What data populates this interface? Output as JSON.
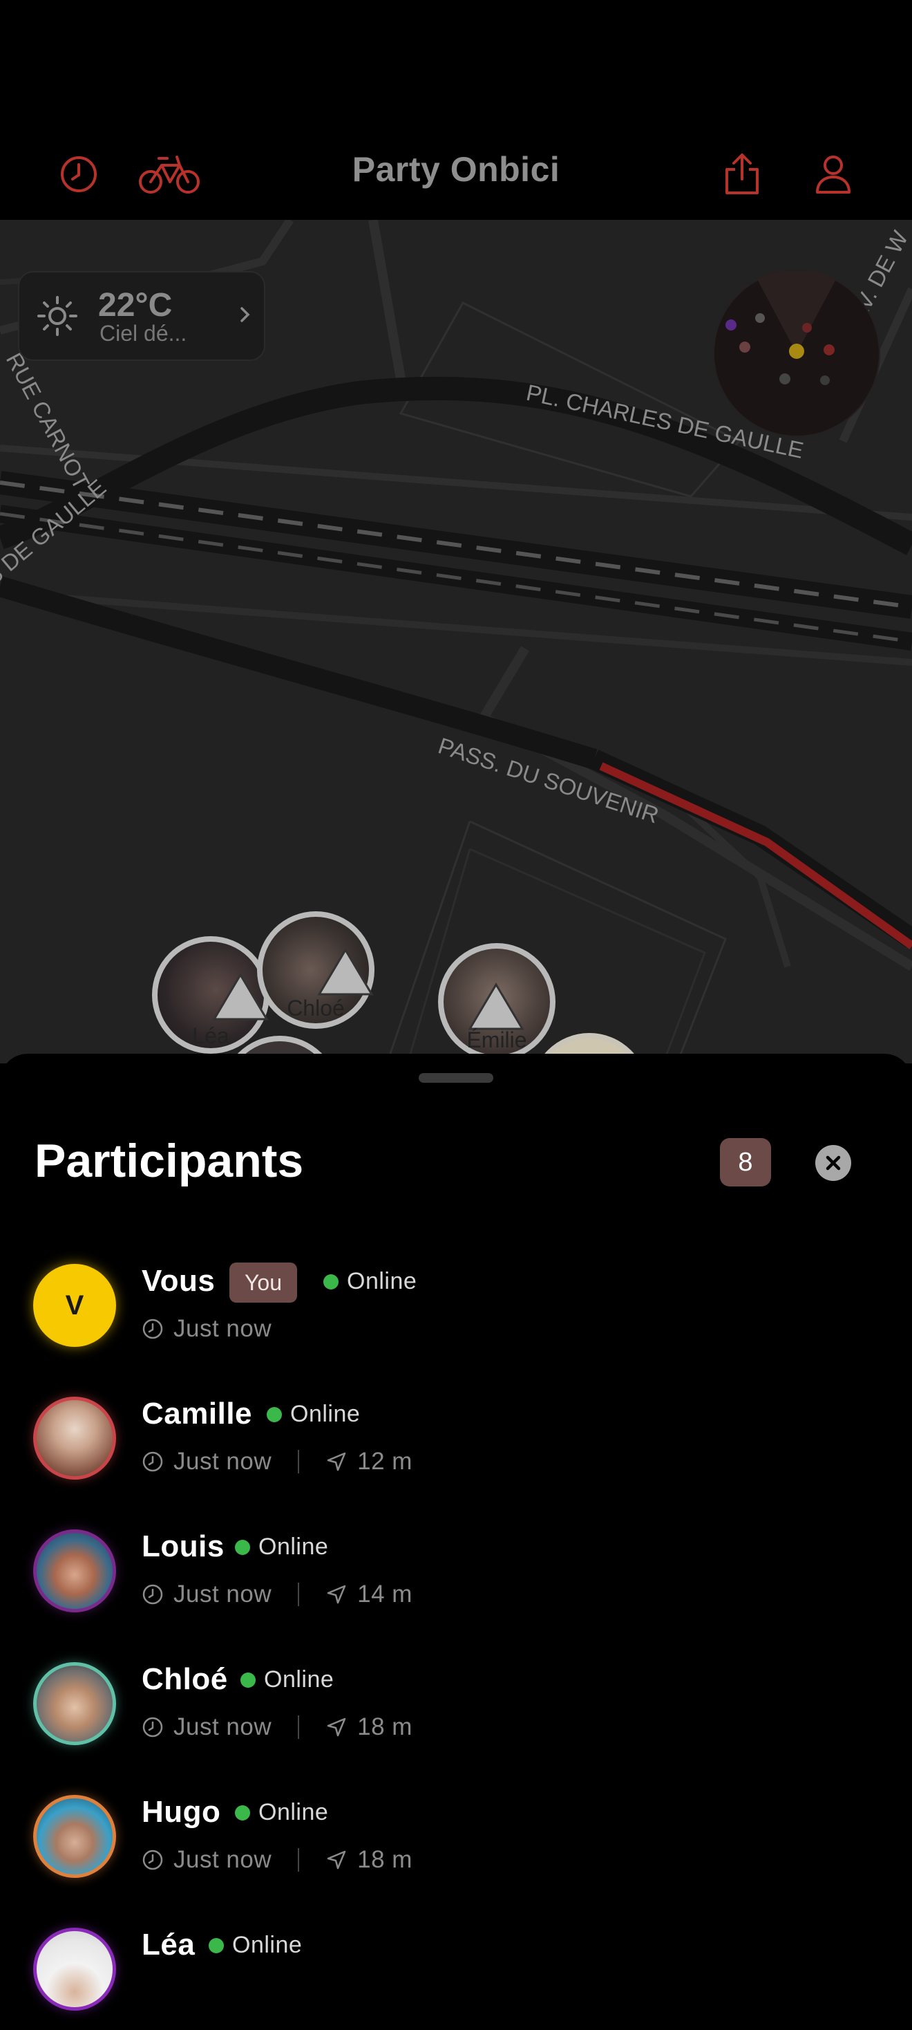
{
  "header": {
    "title": "Party Onbici",
    "icons": [
      "history-icon",
      "bike-icon",
      "share-icon",
      "profile-icon"
    ],
    "accent_color": "#b8322c"
  },
  "map": {
    "weather": {
      "temperature": "22°C",
      "description": "Ciel dé..."
    },
    "street_labels": [
      "PL. CHARLES DE GAULLE",
      "PASS. DU SOUVENIR",
      "RUE CARNOT",
      "S DE GAULLE",
      "AV. DE W"
    ],
    "markers": [
      "Léa",
      "Chloé",
      "Émilie"
    ]
  },
  "sheet": {
    "title": "Participants",
    "count": "8",
    "participants": [
      {
        "name": "Vous",
        "initial": "V",
        "badge": "You",
        "status": "Online",
        "time": "Just now",
        "distance": ""
      },
      {
        "name": "Camille",
        "status": "Online",
        "time": "Just now",
        "distance": "12 m"
      },
      {
        "name": "Louis",
        "status": "Online",
        "time": "Just now",
        "distance": "14 m"
      },
      {
        "name": "Chloé",
        "status": "Online",
        "time": "Just now",
        "distance": "18 m"
      },
      {
        "name": "Hugo",
        "status": "Online",
        "time": "Just now",
        "distance": "18 m"
      },
      {
        "name": "Léa",
        "status": "Online",
        "time": "",
        "distance": ""
      }
    ]
  }
}
